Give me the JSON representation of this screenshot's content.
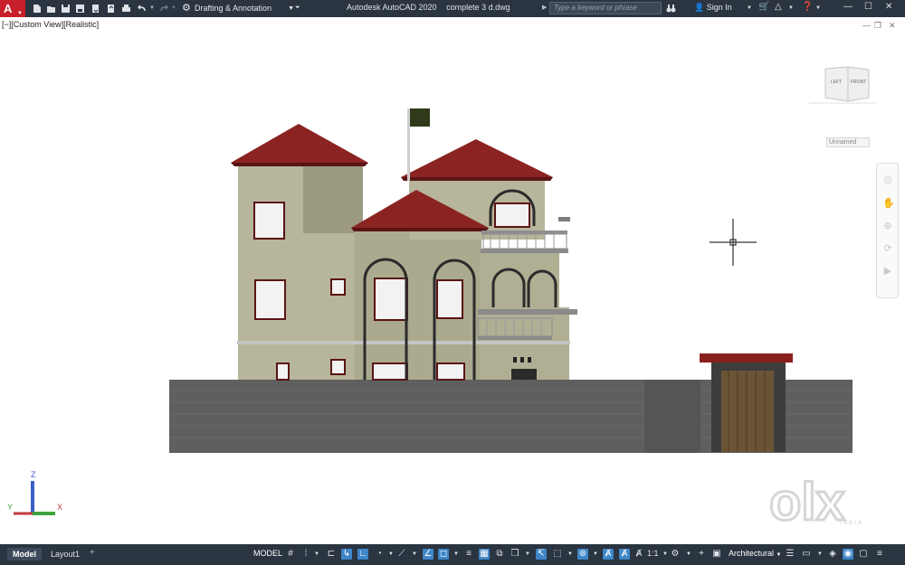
{
  "title_bar": {
    "app_logo": "A",
    "workspace": "Drafting & Annotation",
    "app_title": "Autodesk AutoCAD 2020",
    "document": "complete 3 d.dwg",
    "search_placeholder": "Type a keyword or phrase",
    "sign_in": "Sign In"
  },
  "viewport": {
    "view_label": "[−][Custom View][Realistic]",
    "viewcube_left": "LEFT",
    "viewcube_front": "FRONT",
    "wcs_label": "Unnamed",
    "ucs_z": "Z",
    "ucs_y": "Y",
    "ucs_x": "X"
  },
  "watermark": {
    "brand": "olx",
    "sub": "INDIA"
  },
  "status_bar": {
    "tabs": [
      {
        "label": "Model",
        "active": true
      },
      {
        "label": "Layout1",
        "active": false
      }
    ],
    "model_button": "MODEL",
    "annotation_scale": "1:1",
    "units": "Architectural"
  },
  "colors": {
    "chrome": "#2b3441",
    "autocad_red": "#c8202a",
    "roof": "#8a1f1f",
    "wall": "#b4b397",
    "boundary_wall": "#5f5f5f",
    "active_toggle": "#3e86c8"
  }
}
